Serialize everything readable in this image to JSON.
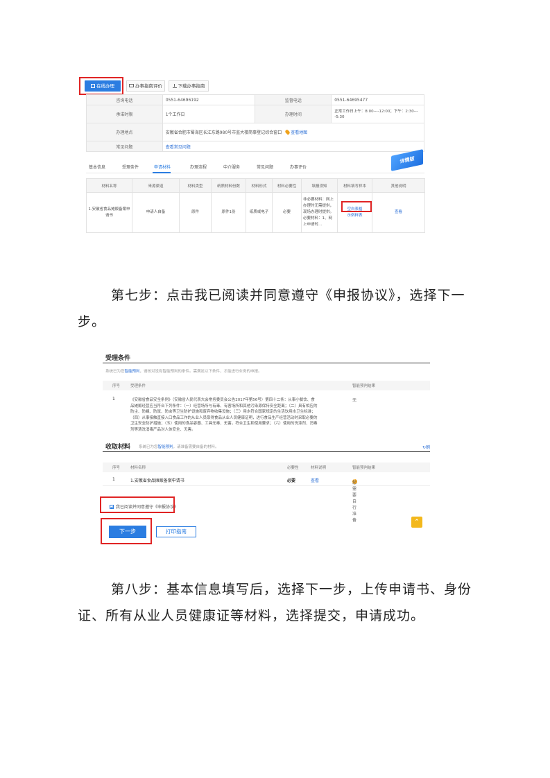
{
  "shot1": {
    "buttons": {
      "online": "在线办理",
      "eval": "办事指南评价",
      "download": "下载办事指南"
    },
    "info": {
      "consult_label": "咨询电话",
      "consult_value": "0551-64696192",
      "supervise_label": "监督电话",
      "supervise_value": "0551-64695477",
      "promise_label": "承诺时限",
      "promise_value": "1个工作日",
      "hours_label": "办理时间",
      "hours_value": "正常工作日上午：8:00----12:00；下午：2:30----5:30",
      "place_label": "办理地点",
      "place_value": "安徽省合肥市蜀海区长江东路980号市监大楼简事登记综合窗口",
      "map_link": "查看地图",
      "faq_label": "常见问题",
      "faq_link": "查看常见问题"
    },
    "tabs": [
      "基本信息",
      "受理条件",
      "申请材料",
      "办理流程",
      "中介服务",
      "常见问题",
      "办事评价"
    ],
    "ribbon": "详情版",
    "materials": {
      "headers": [
        "材料名称",
        "来源渠道",
        "材料类型",
        "纸质材料份数",
        "材料形式",
        "材料必要性",
        "填报须知",
        "材料填写样本",
        "其他说明"
      ],
      "row": {
        "name": "1.安徽省食品摊贩备案申请书",
        "source": "申请人自备",
        "type": "原件",
        "copies": "原件1份",
        "form": "纸质或电子",
        "necessity": "必要",
        "notes": "非必要材料：网上办理时无需提供，现场办理时提供。必要材料：1、网上申请时…",
        "blank_form": "空白表格",
        "sample_form": "示例样表",
        "other": "查看"
      }
    }
  },
  "paragraphs": {
    "step7": "第七步：点击我已阅读并同意遵守《申报协议》，选择下一步。",
    "step8": "第八步：基本信息填写后，选择下一步，上传申请书、身份证、所有从业人员健康证等材料，选择提交，申请成功。"
  },
  "shot2": {
    "conditions": {
      "title": "受理条件",
      "note_prefix": "系统已为您",
      "note_link": "智能预判",
      "note_suffix": "，请核对没有智能预判的条件。需满足以下条件，才能进行业务的申报。",
      "col_no": "序号",
      "col_cond": "受理条件",
      "col_result": "智能预判结果",
      "row_no": "1",
      "row_text": "《安徽省食品安全条例》（安徽省人民代表大会常务委员会公告2017年第56号）第四十二条：从事小餐饮、食品摊贩经营应当符合下列条件：（一）经营场所与有毒、有害场所和其他污染源保持安全距离；（二）具有相应的防尘、防蝇、防鼠、防虫等卫生防护设施和废弃物收集设施；（三）用水符合国家规定的生活饮用水卫生标准；（四）从事接触直接入口食品工作的从业人员取得食品从业人员健康证明，进行食品生产经营活动时采取必要的卫生安全防护措施；（五）使用的食品容器、工具无毒、无害，符合卫生和使用要求；（六）使用的洗涤剂、消毒剂等清洗消毒产品对人体安全、无害。",
      "row_result": "无"
    },
    "materials": {
      "title": "收取材料",
      "note_prefix": "系统已为您",
      "note_link": "智能预判",
      "note_suffix": "，请准备需要自备的材料。",
      "refresh": "刷",
      "col_no": "序号",
      "col_name": "材料名称",
      "col_need": "必要性",
      "col_desc": "材料说明",
      "col_result": "智能预判结果",
      "row_no": "1",
      "row_name": "1.安徽省食品摊贩备案申请书",
      "row_need": "必要",
      "row_desc": "查看",
      "row_result": "您需要自行准备"
    },
    "agree_text": "我已阅读并同意遵守《申报协议》",
    "next_button": "下一步",
    "print_button": "打印指南",
    "top_button": "⌃"
  }
}
